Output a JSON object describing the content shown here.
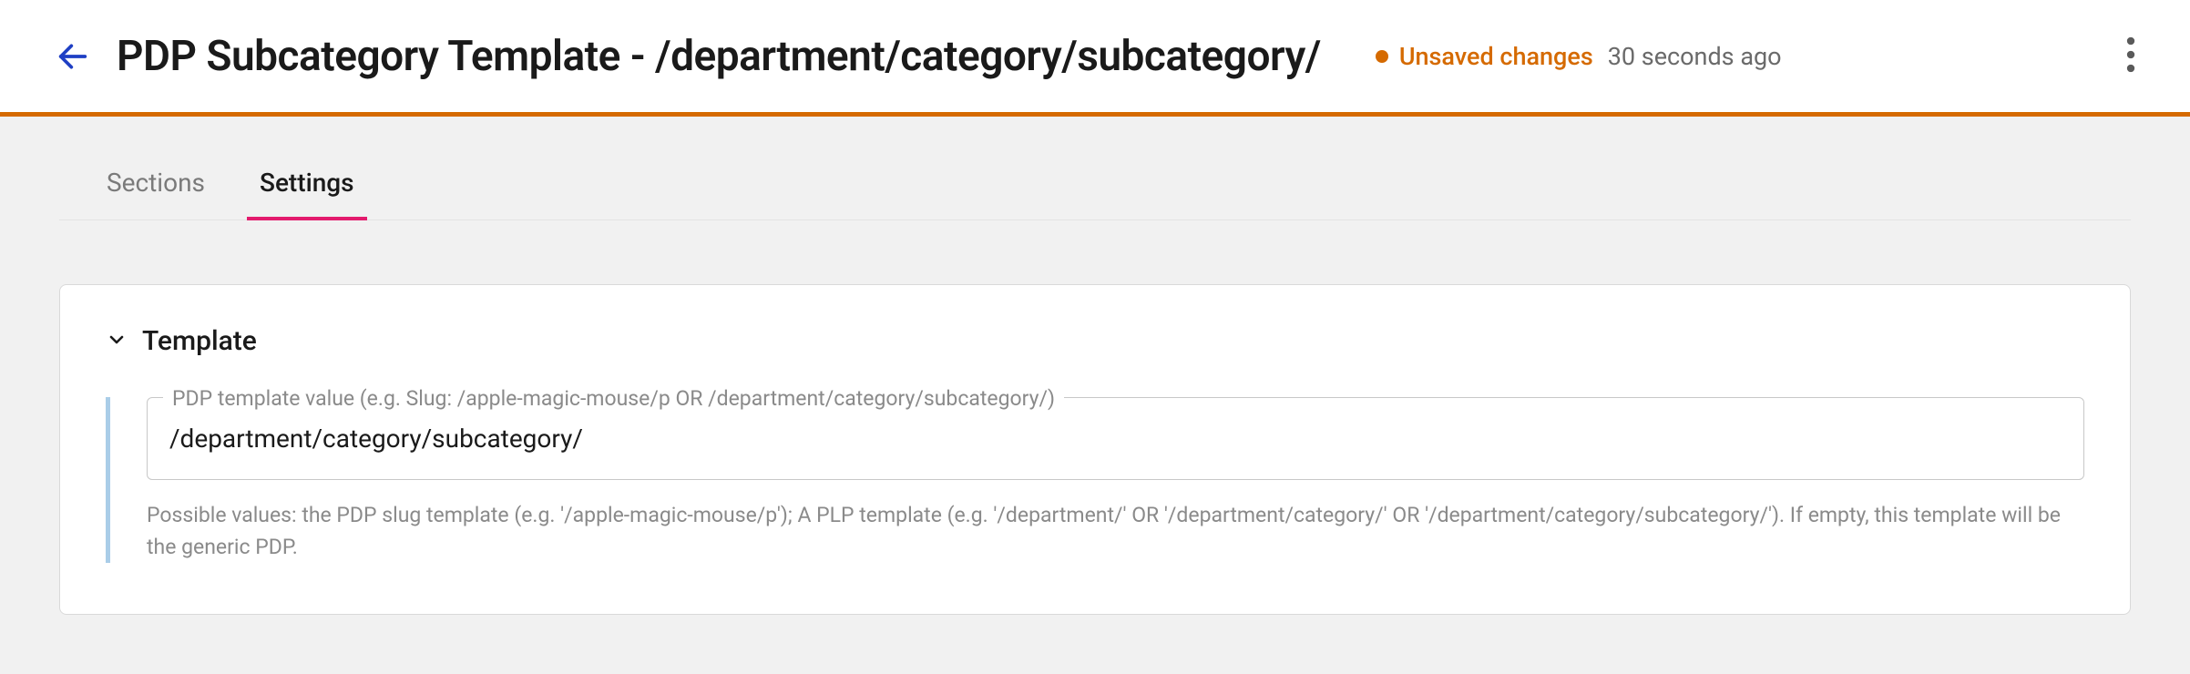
{
  "header": {
    "title": "PDP Subcategory Template - /department/category/subcategory/",
    "status_label": "Unsaved changes",
    "status_time": "30 seconds ago"
  },
  "tabs": {
    "sections": "Sections",
    "settings": "Settings"
  },
  "card": {
    "title": "Template",
    "field_label": "PDP template value (e.g. Slug: /apple-magic-mouse/p OR /department/category/subcategory/)",
    "field_value": "/department/category/subcategory/",
    "help_text": "Possible values: the PDP slug template (e.g. '/apple-magic-mouse/p'); A PLP template (e.g. '/department/' OR '/department/category/' OR '/department/category/subcategory/'). If empty, this template will be the generic PDP."
  }
}
